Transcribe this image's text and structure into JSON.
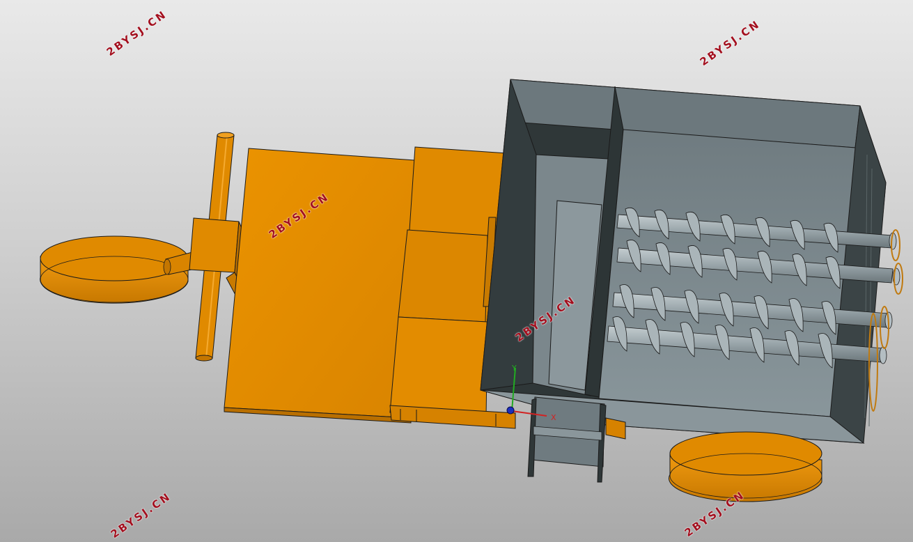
{
  "watermark": {
    "text": "2BYSJ.CN",
    "color": "#a30f1e"
  },
  "model": {
    "colors": {
      "orange_part": "#e08a00",
      "orange_dark": "#b96f00",
      "hopper_gray": "#7a868b",
      "hopper_dark": "#2f3738",
      "auger_gray": "#9aa6ab",
      "edge": "#1a1a1a"
    }
  },
  "triad": {
    "x_label": "X",
    "y_label": "Y",
    "x_color": "#d22222",
    "y_color": "#22aa22",
    "z_color": "#1b2fbf"
  }
}
